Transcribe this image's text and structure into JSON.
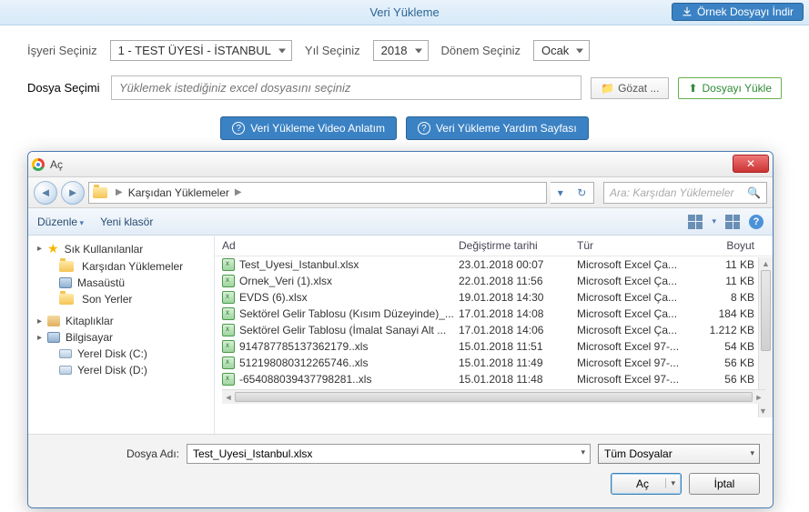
{
  "topbar": {
    "title": "Veri Yükleme",
    "download_sample": "Örnek Dosyayı İndir"
  },
  "form": {
    "workplace_label": "İşyeri Seçiniz",
    "workplace_value": "1 - TEST ÜYESİ - İSTANBUL",
    "year_label": "Yıl Seçiniz",
    "year_value": "2018",
    "period_label": "Dönem Seçiniz",
    "period_value": "Ocak"
  },
  "file": {
    "label": "Dosya Seçimi",
    "placeholder": "Yüklemek istediğiniz excel dosyasını seçiniz",
    "browse": "Gözat ...",
    "upload": "Dosyayı Yükle"
  },
  "help": {
    "video": "Veri Yükleme Video Anlatım",
    "page": "Veri Yükleme Yardım Sayfası"
  },
  "dialog": {
    "title": "Aç",
    "breadcrumb": "Karşıdan Yüklemeler",
    "search_placeholder": "Ara: Karşıdan Yüklemeler",
    "organize": "Düzenle",
    "new_folder": "Yeni klasör",
    "col_name": "Ad",
    "col_date": "Değiştirme tarihi",
    "col_type": "Tür",
    "col_size": "Boyut",
    "filename_label": "Dosya Adı:",
    "filename_value": "Test_Uyesi_Istanbul.xlsx",
    "filetype_value": "Tüm Dosyalar",
    "open_btn": "Aç",
    "cancel_btn": "İptal"
  },
  "tree": {
    "favorites": "Sık Kullanılanlar",
    "downloads": "Karşıdan Yüklemeler",
    "desktop": "Masaüstü",
    "recent": "Son Yerler",
    "libraries": "Kitaplıklar",
    "computer": "Bilgisayar",
    "disk_c": "Yerel Disk (C:)",
    "disk_d": "Yerel Disk (D:)"
  },
  "files": [
    {
      "name": "Test_Uyesi_Istanbul.xlsx",
      "date": "23.01.2018 00:07",
      "type": "Microsoft Excel Ça...",
      "size": "11 KB"
    },
    {
      "name": "Ornek_Veri (1).xlsx",
      "date": "22.01.2018 11:56",
      "type": "Microsoft Excel Ça...",
      "size": "11 KB"
    },
    {
      "name": "EVDS (6).xlsx",
      "date": "19.01.2018 14:30",
      "type": "Microsoft Excel Ça...",
      "size": "8 KB"
    },
    {
      "name": "Sektörel Gelir Tablosu (Kısım Düzeyinde)_...",
      "date": "17.01.2018 14:08",
      "type": "Microsoft Excel Ça...",
      "size": "184 KB"
    },
    {
      "name": "Sektörel Gelir Tablosu (İmalat Sanayi Alt ...",
      "date": "17.01.2018 14:06",
      "type": "Microsoft Excel Ça...",
      "size": "1.212 KB"
    },
    {
      "name": "914787785137362179..xls",
      "date": "15.01.2018 11:51",
      "type": "Microsoft Excel 97-...",
      "size": "54 KB"
    },
    {
      "name": "512198080312265746..xls",
      "date": "15.01.2018 11:49",
      "type": "Microsoft Excel 97-...",
      "size": "56 KB"
    },
    {
      "name": "-654088039437798281..xls",
      "date": "15.01.2018 11:48",
      "type": "Microsoft Excel 97-...",
      "size": "56 KB"
    }
  ]
}
